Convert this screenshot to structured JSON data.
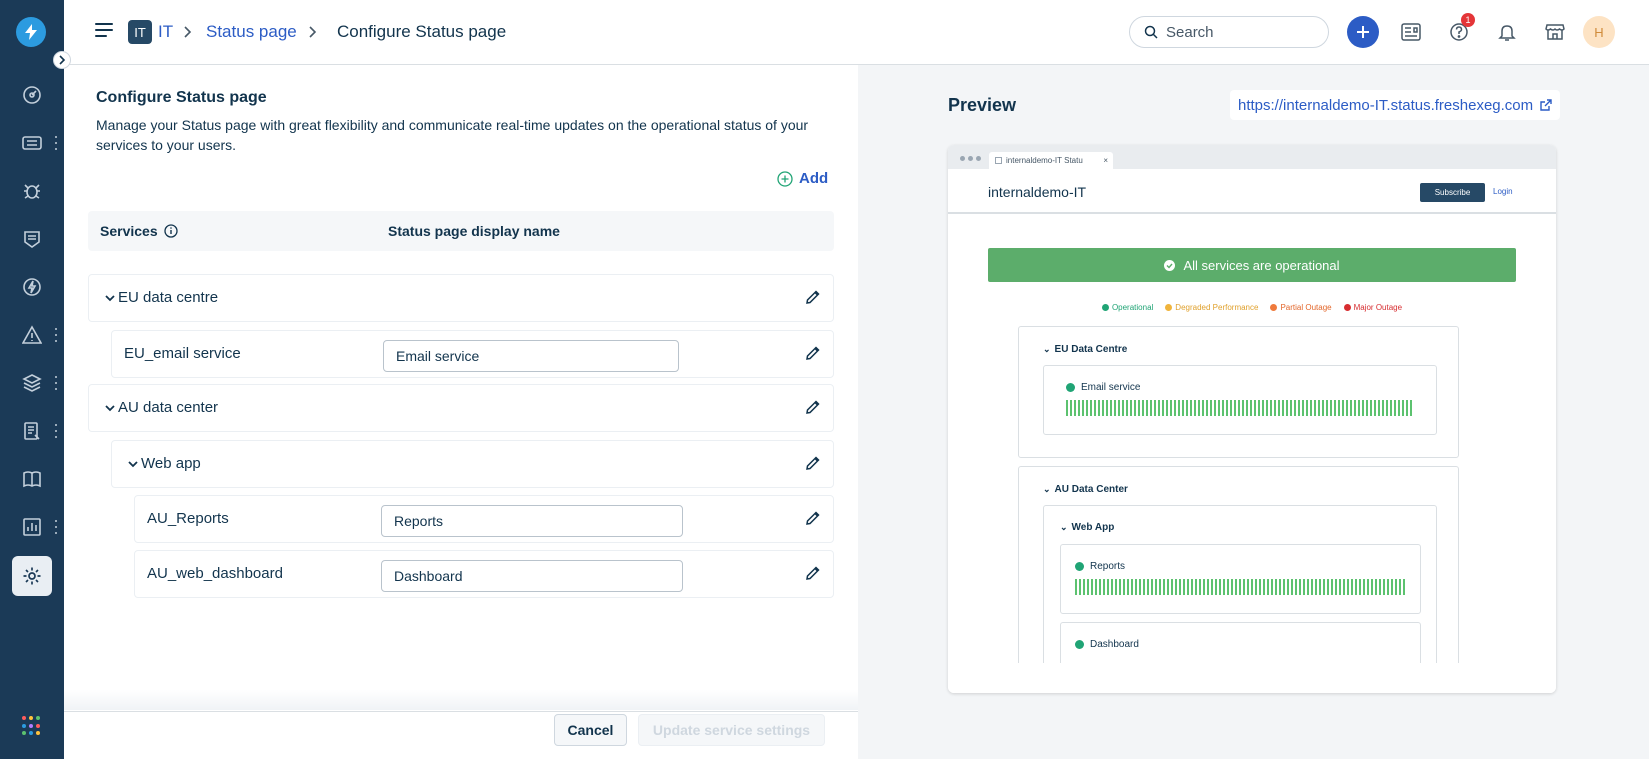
{
  "header": {
    "workspace_badge": "IT",
    "breadcrumb": [
      "IT",
      "Status page",
      "Configure Status page"
    ],
    "search_placeholder": "Search",
    "help_badge_count": "1",
    "avatar_initial": "H"
  },
  "config": {
    "title": "Configure Status page",
    "description": "Manage your Status page with great flexibility and communicate real-time updates on the operational status of your services to your users.",
    "add_label": "Add",
    "columns": [
      "Services",
      "Status page display name"
    ],
    "rows": [
      {
        "name": "EU data centre",
        "display": null
      },
      {
        "name": "EU_email service",
        "display": "Email service"
      },
      {
        "name": "AU data center",
        "display": null
      },
      {
        "name": "Web app",
        "display": null
      },
      {
        "name": "AU_Reports",
        "display": "Reports"
      },
      {
        "name": "AU_web_dashboard",
        "display": "Dashboard"
      }
    ],
    "cancel_label": "Cancel",
    "update_label": "Update service settings"
  },
  "preview": {
    "title": "Preview",
    "url": "https://internaldemo-IT.status.freshexeg.com",
    "browser_tab": "internaldemo-IT Statu",
    "tab_close": "×",
    "site_name": "internaldemo-IT",
    "subscribe_label": "Subscribe",
    "login_label": "Login",
    "banner": "All services are operational",
    "legend": [
      {
        "label": "Operational",
        "color": "#20a475"
      },
      {
        "label": "Degraded Performance",
        "color": "#f0b43c"
      },
      {
        "label": "Partial Outage",
        "color": "#ef7a3c"
      },
      {
        "label": "Major Outage",
        "color": "#d72d30"
      }
    ],
    "groups": {
      "eu": "EU Data Centre",
      "eu_service": "Email service",
      "au": "AU Data Center",
      "au_sub": "Web App",
      "au_service_1": "Reports",
      "au_service_2": "Dashboard"
    }
  },
  "colors": {
    "nav_bg": "#1b3a57",
    "accent": "#2c5cc5",
    "operational": "#5cad6b"
  }
}
